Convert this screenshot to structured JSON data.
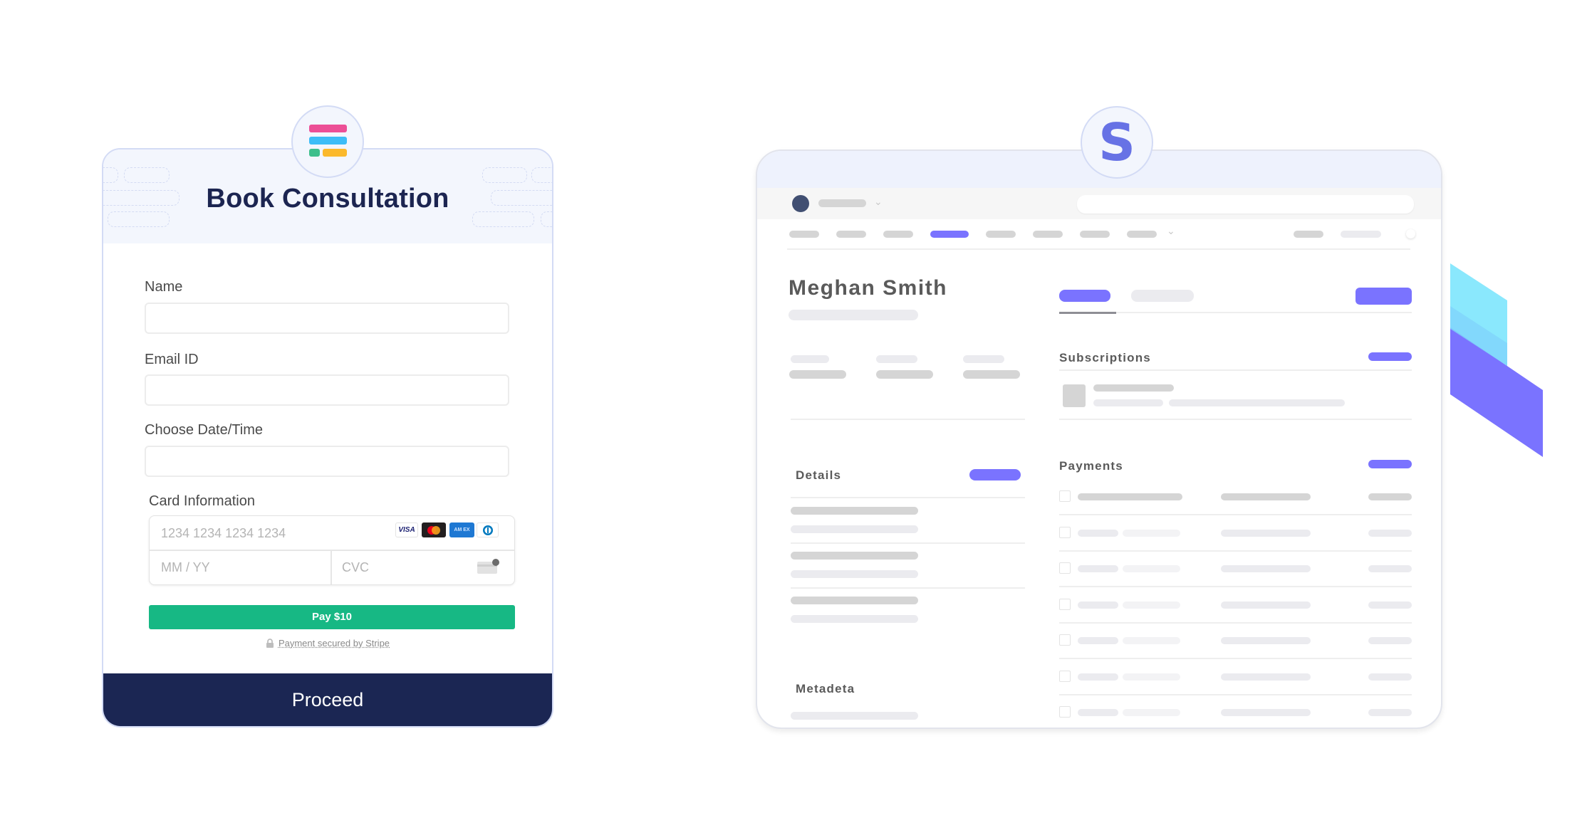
{
  "booking_form": {
    "logo_icon": "form-builder-logo-icon",
    "logo_colors": {
      "bar1": "#ec4f96",
      "bar2": "#3dbdf7",
      "bar3a": "#3dbf8c",
      "bar3b": "#fbb92c"
    },
    "title": "Book Consultation",
    "fields": [
      {
        "label": "Name",
        "value": "",
        "placeholder": ""
      },
      {
        "label": "Email ID",
        "value": "",
        "placeholder": ""
      },
      {
        "label": "Choose Date/Time",
        "value": "",
        "placeholder": ""
      }
    ],
    "card": {
      "label": "Card Information",
      "number_placeholder": "1234 1234 1234 1234",
      "expiry_placeholder": "MM / YY",
      "cvc_placeholder": "CVC",
      "brands": [
        "VISA",
        "Mastercard",
        "Amex",
        "Diners"
      ],
      "cvc_icon": "cvc-card-icon"
    },
    "pay_button": "Pay $10",
    "pay_color": "#17b884",
    "secured_text": "Payment secured by Stripe",
    "lock_icon": "lock-icon",
    "proceed_button": "Proceed",
    "proceed_color": "#1b2653"
  },
  "stripe_dashboard": {
    "logo_letter": "S",
    "logo_color": "#6772e5",
    "accent_color": "#7a73ff",
    "customer_name": "Meghan Smith",
    "sections": {
      "subscriptions": "Subscriptions",
      "details": "Details",
      "payments": "Payments",
      "metadata": "Metadeta"
    },
    "active_nav_index": 3,
    "payment_rows": 7
  },
  "decoration": {
    "shape_colors": [
      "#8ae8fd",
      "#7a73ff"
    ]
  }
}
